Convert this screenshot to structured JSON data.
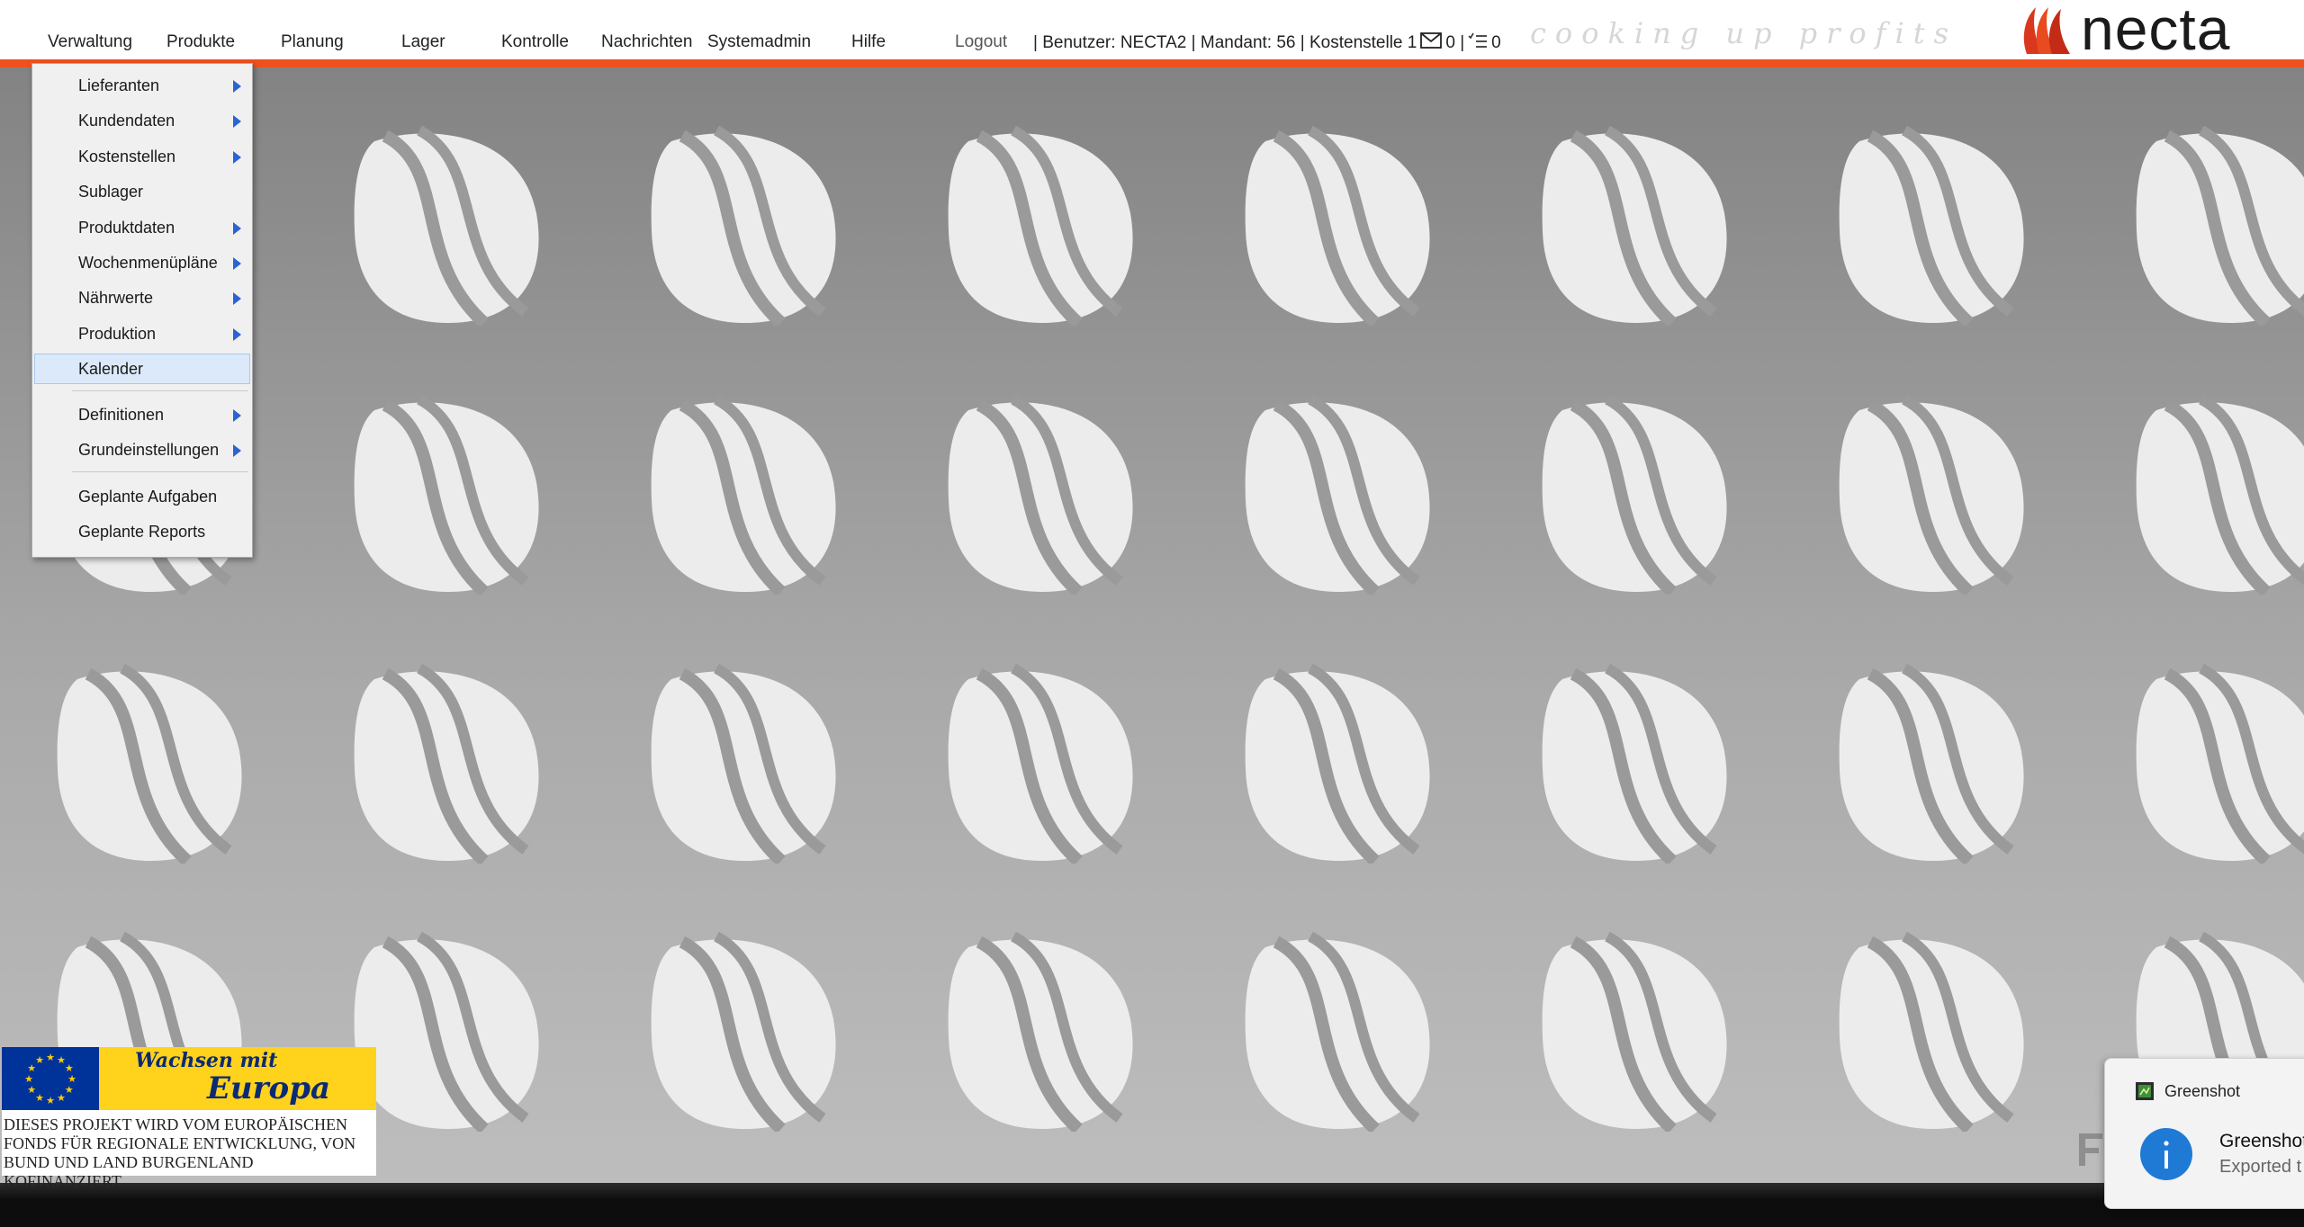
{
  "app": {
    "slogan": "cooking up profits",
    "logo_text": "necta",
    "accent_color": "#f0501e"
  },
  "nav": {
    "items": [
      {
        "label": "Verwaltung"
      },
      {
        "label": "Produkte"
      },
      {
        "label": "Planung"
      },
      {
        "label": "Lager"
      },
      {
        "label": "Kontrolle"
      },
      {
        "label": "Nachrichten"
      },
      {
        "label": "Systemadmin"
      },
      {
        "label": "Hilfe"
      }
    ],
    "logout": "Logout"
  },
  "user_info": {
    "text": "| Benutzer: NECTA2 | Mandant: 56 | Kostenstelle 1",
    "messages_count": "0 |",
    "tasks_count": "0",
    "messages_icon": "envelope-icon",
    "tasks_icon": "task-list-icon"
  },
  "dropdown": {
    "parent": "Verwaltung",
    "items": [
      {
        "label": "Lieferanten",
        "submenu": true
      },
      {
        "label": "Kundendaten",
        "submenu": true
      },
      {
        "label": "Kostenstellen",
        "submenu": true
      },
      {
        "label": "Sublager",
        "submenu": false
      },
      {
        "label": "Produktdaten",
        "submenu": true
      },
      {
        "label": "Wochenmenüpläne",
        "submenu": true
      },
      {
        "label": "Nährwerte",
        "submenu": true
      },
      {
        "label": "Produktion",
        "submenu": true
      },
      {
        "label": "Kalender",
        "submenu": false,
        "highlighted": true
      },
      {
        "label": "Definitionen",
        "submenu": true
      },
      {
        "label": "Grundeinstellungen",
        "submenu": true
      },
      {
        "label": "Geplante Aufgaben",
        "submenu": false
      },
      {
        "label": "Geplante Reports",
        "submenu": false
      }
    ]
  },
  "eu_badge": {
    "title_line1": "Wachsen mit",
    "title_line2": "Europa",
    "text": "DIESES PROJEKT WIRD VOM EUROPÄISCHEN FONDS FÜR REGIONALE ENTWICKLUNG, VON BUND UND LAND BURGENLAND KOFINANZIERT."
  },
  "notification": {
    "app_name": "Greenshot",
    "title": "Greenshot",
    "body": "Exported t",
    "icon": "info-icon"
  }
}
